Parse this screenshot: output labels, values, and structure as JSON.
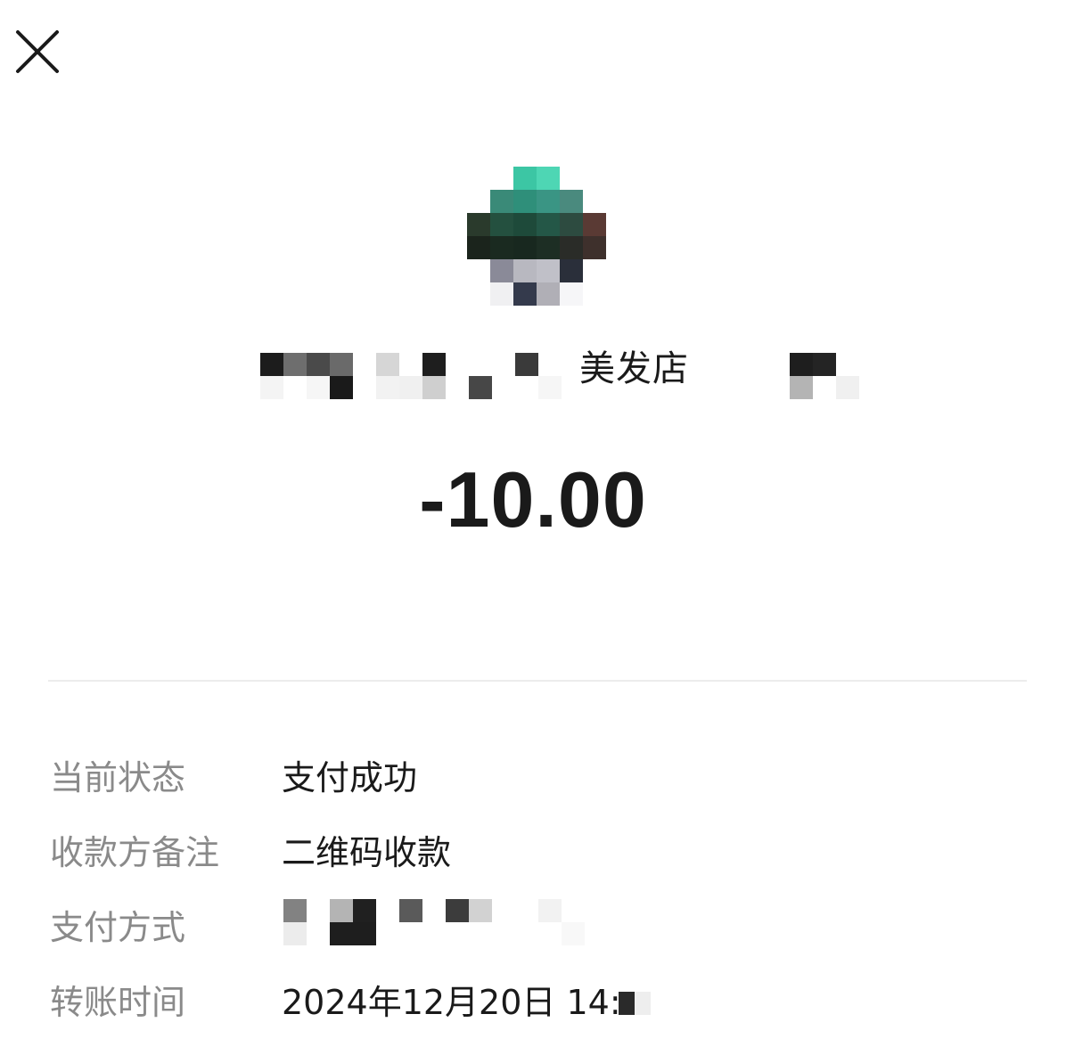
{
  "header": {
    "close_icon": "close-icon"
  },
  "merchant": {
    "visible_name": "美发店"
  },
  "transaction": {
    "amount": "-10.00"
  },
  "details": [
    {
      "label": "当前状态",
      "value": "支付成功"
    },
    {
      "label": "收款方备注",
      "value": "二维码收款"
    },
    {
      "label": "支付方式",
      "value": ""
    },
    {
      "label": "转账时间",
      "value": "2024年12月20日 14:"
    }
  ]
}
